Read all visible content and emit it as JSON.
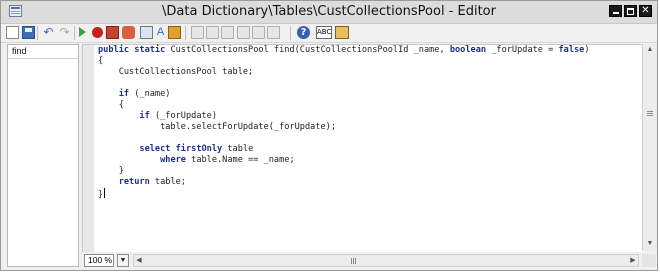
{
  "window": {
    "title": "\\Data Dictionary\\Tables\\CustCollectionsPool - Editor",
    "controls": [
      "minimize",
      "maximize",
      "close"
    ],
    "close_glyph": "✕"
  },
  "toolbar": {
    "icons": [
      "new-icon",
      "save-icon",
      "undo-icon",
      "redo-icon",
      "run-icon",
      "breakpoint-icon",
      "toggle-breakpoint-icon",
      "remove-breakpoints-icon",
      "compile-icon",
      "lookup-icon",
      "script-icon",
      "copy-icon",
      "paste-icon",
      "find-icon",
      "replace-icon",
      "help-icon",
      "source-icon",
      "bookmark-icon"
    ],
    "undo_glyph": "↶",
    "redo_glyph": "↷",
    "help_glyph": "?",
    "source_glyph": "ABC"
  },
  "method_list": {
    "items": [
      "find"
    ]
  },
  "editor": {
    "lines": [
      [
        {
          "t": "public static ",
          "k": 1
        },
        {
          "t": "CustCollectionsPool find(CustCollectionsPoolId _name, "
        },
        {
          "t": "boolean",
          "k": 1
        },
        {
          "t": " _forUpdate = "
        },
        {
          "t": "false",
          "k": 1
        },
        {
          "t": ")"
        }
      ],
      [
        {
          "t": "{"
        }
      ],
      [
        {
          "t": "    CustCollectionsPool table;"
        }
      ],
      [
        {
          "t": ""
        }
      ],
      [
        {
          "t": "    "
        },
        {
          "t": "if",
          "k": 1
        },
        {
          "t": " (_name)"
        }
      ],
      [
        {
          "t": "    {"
        }
      ],
      [
        {
          "t": "        "
        },
        {
          "t": "if",
          "k": 1
        },
        {
          "t": " (_forUpdate)"
        }
      ],
      [
        {
          "t": "            table.selectForUpdate(_forUpdate);"
        }
      ],
      [
        {
          "t": ""
        }
      ],
      [
        {
          "t": "        "
        },
        {
          "t": "select firstOnly",
          "k": 1
        },
        {
          "t": " table"
        }
      ],
      [
        {
          "t": "            "
        },
        {
          "t": "where",
          "k": 1
        },
        {
          "t": " table.Name == _name;"
        }
      ],
      [
        {
          "t": "    }"
        }
      ],
      [
        {
          "t": "    "
        },
        {
          "t": "return",
          "k": 1
        },
        {
          "t": " table;"
        }
      ],
      [
        {
          "t": "}"
        },
        {
          "caret": true
        }
      ]
    ]
  },
  "status": {
    "zoom": "100 %",
    "zoom_dropdown": "▼",
    "scroll_up": "▲",
    "scroll_down": "▼",
    "scroll_left": "◀",
    "scroll_right": "▶"
  }
}
